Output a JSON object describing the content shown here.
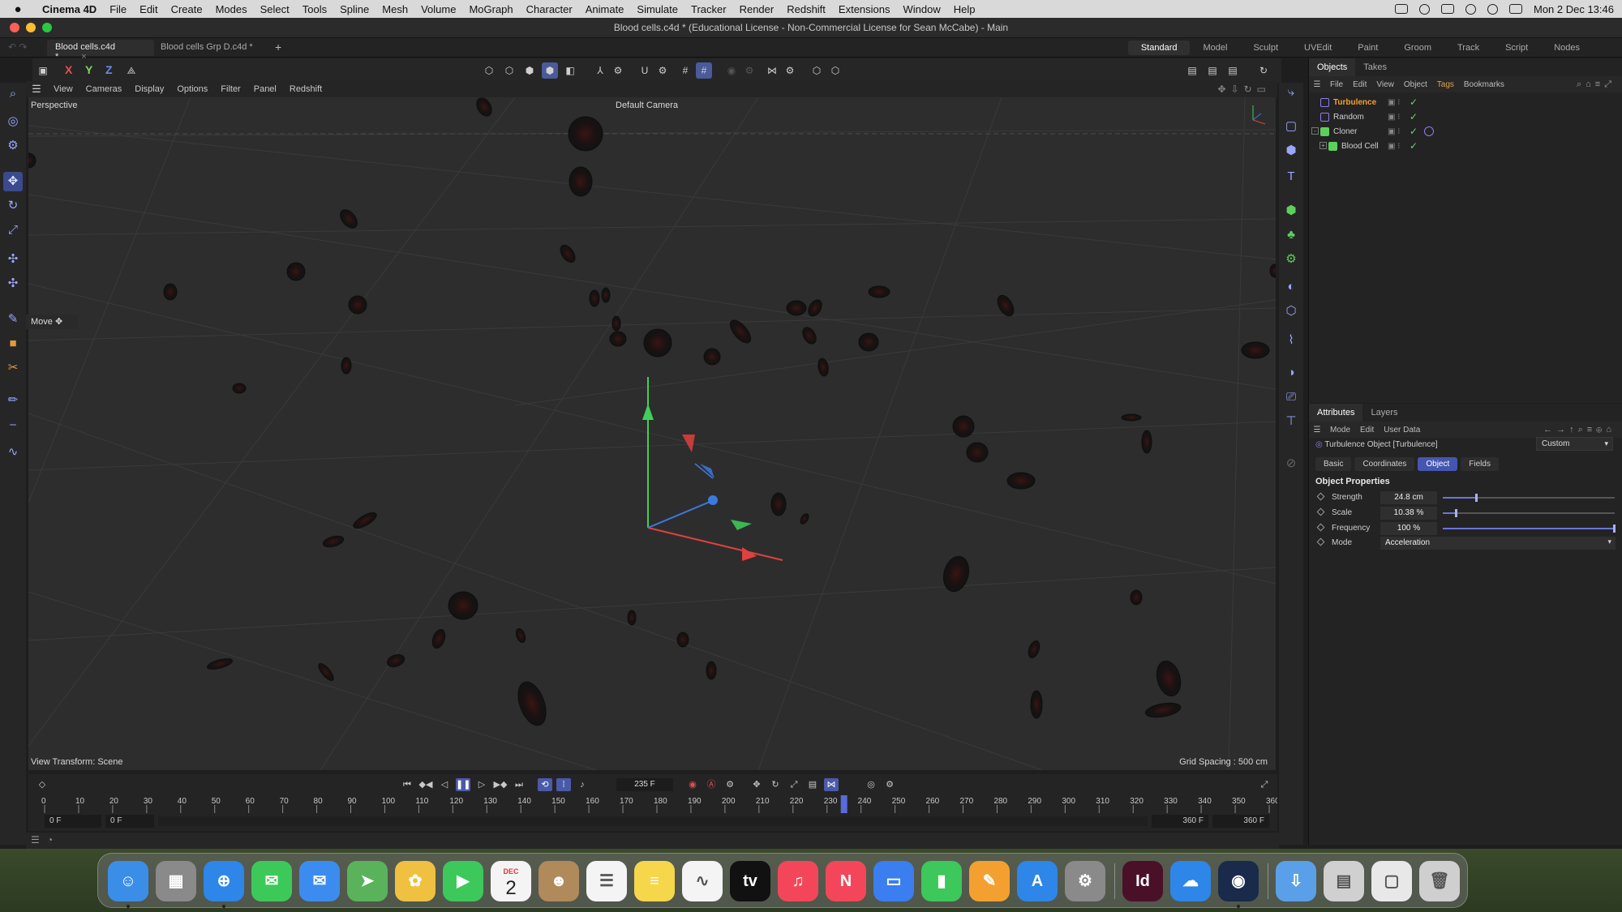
{
  "mac_menu": {
    "app_name": "Cinema 4D",
    "items": [
      "File",
      "Edit",
      "Create",
      "Modes",
      "Select",
      "Tools",
      "Spline",
      "Mesh",
      "Volume",
      "MoGraph",
      "Character",
      "Animate",
      "Simulate",
      "Tracker",
      "Render",
      "Redshift",
      "Extensions",
      "Window",
      "Help"
    ],
    "clock": "Mon 2 Dec  13:46"
  },
  "window": {
    "title": "Blood cells.c4d * (Educational License - Non-Commercial License for Sean McCabe) - Main",
    "tabs": [
      {
        "label": "Blood cells.c4d *",
        "close": "×"
      },
      {
        "label": "Blood cells Grp D.c4d *"
      }
    ],
    "new_tab": "+"
  },
  "layouts": [
    "Standard",
    "Model",
    "Sculpt",
    "UVEdit",
    "Paint",
    "Groom",
    "Track",
    "Script",
    "Nodes"
  ],
  "toolbar": {
    "axes": [
      "X",
      "Y",
      "Z"
    ]
  },
  "viewport": {
    "menu": [
      "View",
      "Cameras",
      "Display",
      "Options",
      "Filter",
      "Panel",
      "Redshift"
    ],
    "view_name": "Perspective",
    "camera": "Default Camera",
    "view_transform": "View Transform: Scene",
    "grid_spacing": "Grid Spacing : 500 cm",
    "tool_tip": "Move"
  },
  "objects_panel": {
    "tabs": [
      "Objects",
      "Takes"
    ],
    "menu": [
      "File",
      "Edit",
      "View",
      "Object",
      "Tags",
      "Bookmarks"
    ],
    "objects": [
      {
        "name": "Turbulence",
        "selected": true,
        "color": "#8d7cf0"
      },
      {
        "name": "Random",
        "selected": false,
        "color": "#8d7cf0"
      },
      {
        "name": "Cloner",
        "selected": false,
        "color": "#5bd05b",
        "expander": "-"
      },
      {
        "name": "Blood Cell",
        "selected": false,
        "color": "#5bd05b",
        "expander": "+"
      }
    ]
  },
  "attributes_panel": {
    "tabs": [
      "Attributes",
      "Layers"
    ],
    "menu": [
      "Mode",
      "Edit",
      "User Data"
    ],
    "object_title": "Turbulence Object [Turbulence]",
    "preset": "Custom",
    "sub_tabs": [
      "Basic",
      "Coordinates",
      "Object",
      "Fields"
    ],
    "active_sub_tab": "Object",
    "section": "Object Properties",
    "properties": [
      {
        "label": "Strength",
        "value": "24.8 cm",
        "slider": 0.2
      },
      {
        "label": "Scale",
        "value": "10.38 %",
        "slider": 0.08
      },
      {
        "label": "Frequency",
        "value": "100 %",
        "slider": 1.0
      }
    ],
    "mode": {
      "label": "Mode",
      "value": "Acceleration"
    }
  },
  "timeline": {
    "current_frame": "235 F",
    "ticks": [
      "0",
      "10",
      "20",
      "30",
      "40",
      "50",
      "60",
      "70",
      "80",
      "90",
      "100",
      "110",
      "120",
      "130",
      "140",
      "150",
      "160",
      "170",
      "180",
      "190",
      "200",
      "210",
      "220",
      "230",
      "240",
      "250",
      "260",
      "270",
      "280",
      "290",
      "300",
      "310",
      "320",
      "330",
      "340",
      "350",
      "360"
    ],
    "playhead_frame": 235,
    "max_frame": 360,
    "range_start": "0 F",
    "range_start2": "0 F",
    "range_end": "360 F",
    "range_end2": "360 F"
  },
  "dock": {
    "calendar_month": "DEC",
    "calendar_day": "2",
    "apps": [
      {
        "name": "Finder",
        "color": "#3a8ee8",
        "glyph": "☺"
      },
      {
        "name": "Launchpad",
        "color": "#8a8a8a",
        "glyph": "▦"
      },
      {
        "name": "Safari",
        "color": "#2d86e8",
        "glyph": "⊕"
      },
      {
        "name": "Messages",
        "color": "#3dc95a",
        "glyph": "✉"
      },
      {
        "name": "Mail",
        "color": "#3c8cf0",
        "glyph": "✉"
      },
      {
        "name": "Maps",
        "color": "#5ab35a",
        "glyph": "➤"
      },
      {
        "name": "Photos",
        "color": "#f0c040",
        "glyph": "✿"
      },
      {
        "name": "FaceTime",
        "color": "#3cc85a",
        "glyph": "▶"
      },
      {
        "name": "Calendar",
        "color": "#f4f4f4",
        "glyph": ""
      },
      {
        "name": "Contacts",
        "color": "#b08a5a",
        "glyph": "☻"
      },
      {
        "name": "Reminders",
        "color": "#f4f4f4",
        "glyph": "☰"
      },
      {
        "name": "Notes",
        "color": "#f6d64a",
        "glyph": "≡"
      },
      {
        "name": "Freeform",
        "color": "#f4f4f4",
        "glyph": "∿"
      },
      {
        "name": "TV",
        "color": "#111111",
        "glyph": "tv"
      },
      {
        "name": "Music",
        "color": "#f4465a",
        "glyph": "♫"
      },
      {
        "name": "News",
        "color": "#f4465a",
        "glyph": "N"
      },
      {
        "name": "Keynote",
        "color": "#3a7ef0",
        "glyph": "▭"
      },
      {
        "name": "Numbers",
        "color": "#3cc85a",
        "glyph": "▮"
      },
      {
        "name": "Pages",
        "color": "#f4a030",
        "glyph": "✎"
      },
      {
        "name": "App Store",
        "color": "#2d86e8",
        "glyph": "A"
      },
      {
        "name": "System Settings",
        "color": "#8a8a8a",
        "glyph": "⚙"
      },
      {
        "name": "InDesign",
        "color": "#4a1028",
        "glyph": "Id"
      },
      {
        "name": "OneDrive",
        "color": "#2d86e8",
        "glyph": "☁"
      },
      {
        "name": "Cinema 4D",
        "color": "#1a2a4a",
        "glyph": "◉"
      },
      {
        "name": "Downloads",
        "color": "#5aa0e8",
        "glyph": "⇩"
      },
      {
        "name": "Recent Window",
        "color": "#d0d0d0",
        "glyph": "▤"
      },
      {
        "name": "Recent Window 2",
        "color": "#e8e8e8",
        "glyph": "▢"
      },
      {
        "name": "Trash",
        "color": "#cfcfcf",
        "glyph": "🗑"
      }
    ]
  }
}
